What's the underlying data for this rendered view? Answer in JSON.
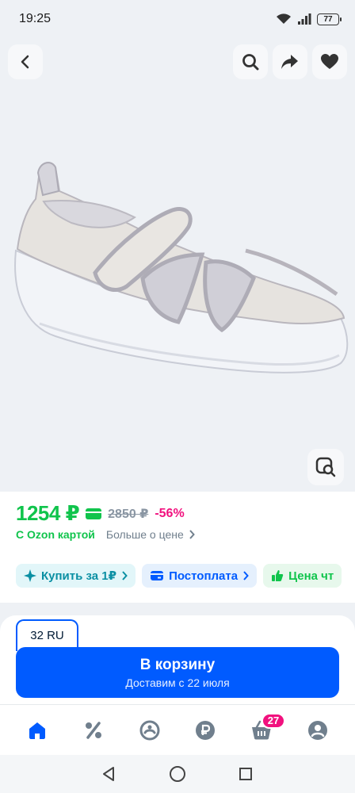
{
  "status_bar": {
    "time": "19:25",
    "battery": "77",
    "icons": [
      "wifi-icon",
      "signal-icon",
      "battery-icon"
    ]
  },
  "product_image": {
    "actions": [
      "back-icon",
      "search-icon",
      "share-icon",
      "heart-icon"
    ],
    "lens_icon": "image-search-icon"
  },
  "price": {
    "current": "1254 ₽",
    "old": "2850 ₽",
    "discount": "-56%",
    "card_label": "С Ozon картой",
    "more_label": "Больше о цене"
  },
  "chips": [
    {
      "label": "Купить за 1₽",
      "icon": "sparkle-icon"
    },
    {
      "label": "Постоплата",
      "icon": "card-icon"
    },
    {
      "label": "Цена чт",
      "icon": "thumbs-up-icon"
    }
  ],
  "size": {
    "selected": "32 RU"
  },
  "cart_button": {
    "title": "В корзину",
    "subtitle": "Доставим с 22 июля"
  },
  "tabbar": {
    "items": [
      "home-icon",
      "percent-icon",
      "fresh-icon",
      "ruble-icon",
      "cart-icon",
      "profile-icon"
    ],
    "cart_badge": "27"
  },
  "colors": {
    "accent": "#005bff",
    "price_green": "#10c44c",
    "discount_pink": "#f1117e"
  }
}
